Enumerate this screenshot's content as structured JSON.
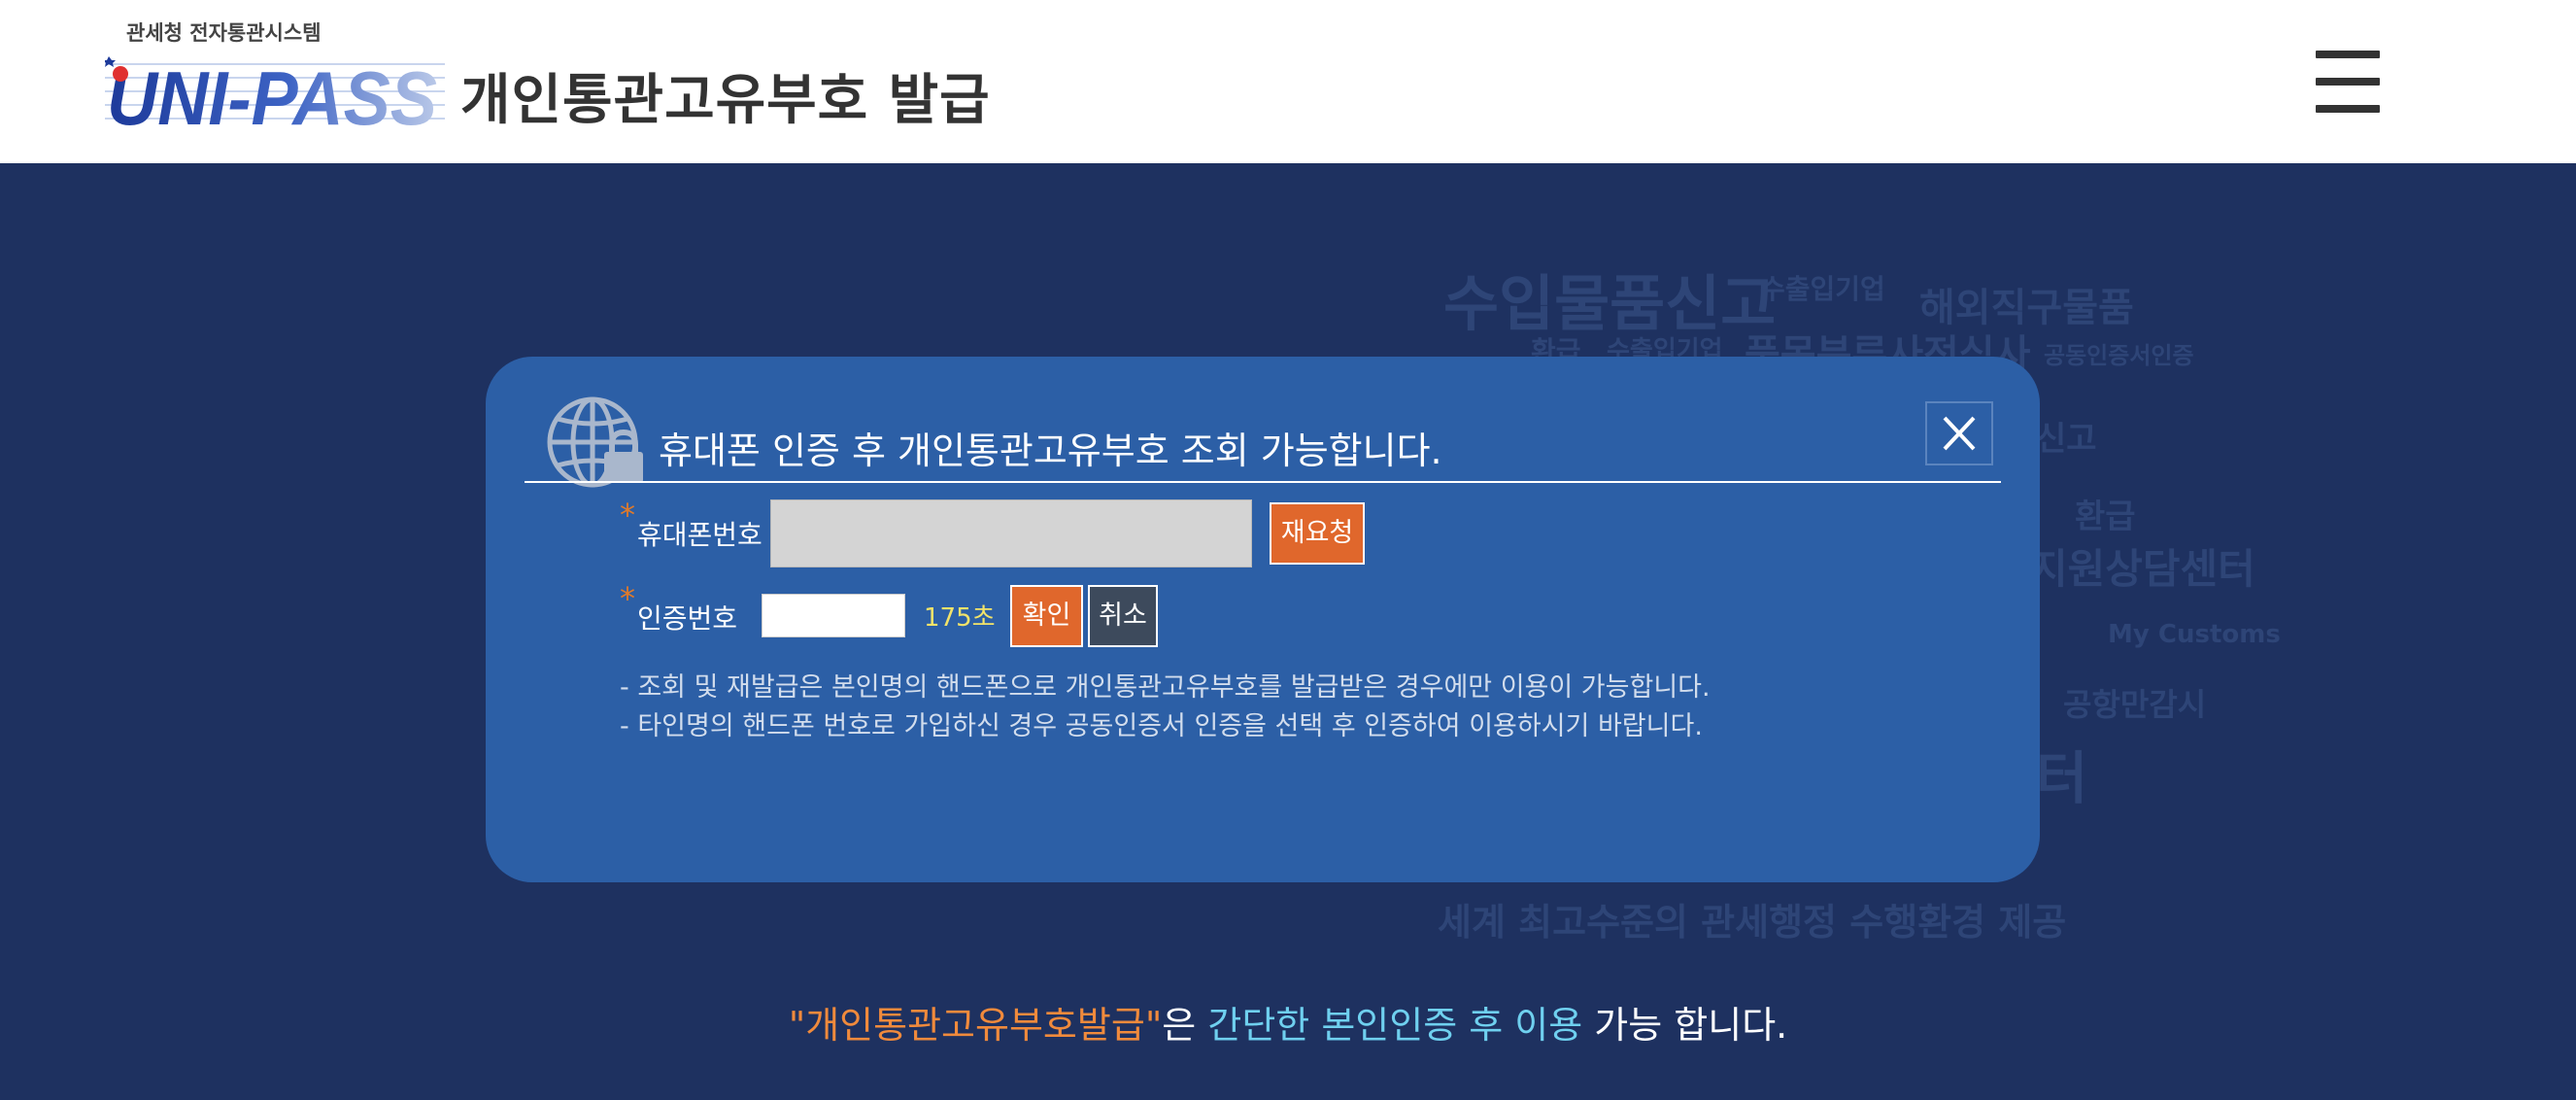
{
  "header": {
    "logo_caption": "관세청 전자통관시스템",
    "logo_text": "UNI-PASS",
    "title": "개인통관고유부호 발급",
    "menu_icon": "hamburger-menu-icon"
  },
  "background_words": [
    "수입물품신고",
    "수출입기업",
    "해외직구물품",
    "환급",
    "수출입기업",
    "품목분류사전심사",
    "공동인증서인증",
    "신고",
    "환급",
    "지원상담센터",
    "My Customs",
    "공항만감시",
    "터",
    "세계 최고수준의 관세행정 수행환경 제공"
  ],
  "modal": {
    "icon": "globe-lock-icon",
    "title": "휴대폰 인증 후 개인통관고유부호 조회 가능합니다.",
    "close_label": "X",
    "phone": {
      "required_mark": "*",
      "label": "휴대폰번호",
      "value": "",
      "resend_label": "재요청"
    },
    "code": {
      "required_mark": "*",
      "label": "인증번호",
      "value": "",
      "timer": "175초",
      "confirm_label": "확인",
      "cancel_label": "취소"
    },
    "notices": [
      "- 조회 및 재발급은 본인명의 핸드폰으로 개인통관고유부호를 발급받은 경우에만 이용이 가능합니다.",
      "- 타인명의 핸드폰 번호로 가입하신 경우 공동인증서 인증을 선택 후 인증하여 이용하시기 바랍니다."
    ]
  },
  "footer": {
    "part1": "\"개인통관고유부호발급\"",
    "part2": "은",
    "part3": "간단한 본인인증 후 이용",
    "part4": "가능 합니다."
  },
  "colors": {
    "page_background": "#1e3160",
    "modal_background": "#2c5fa6",
    "accent_orange": "#e0672c",
    "footer_orange": "#f08a3c",
    "footer_cyan": "#6fd0ef",
    "timer_yellow": "#f2e36a"
  }
}
